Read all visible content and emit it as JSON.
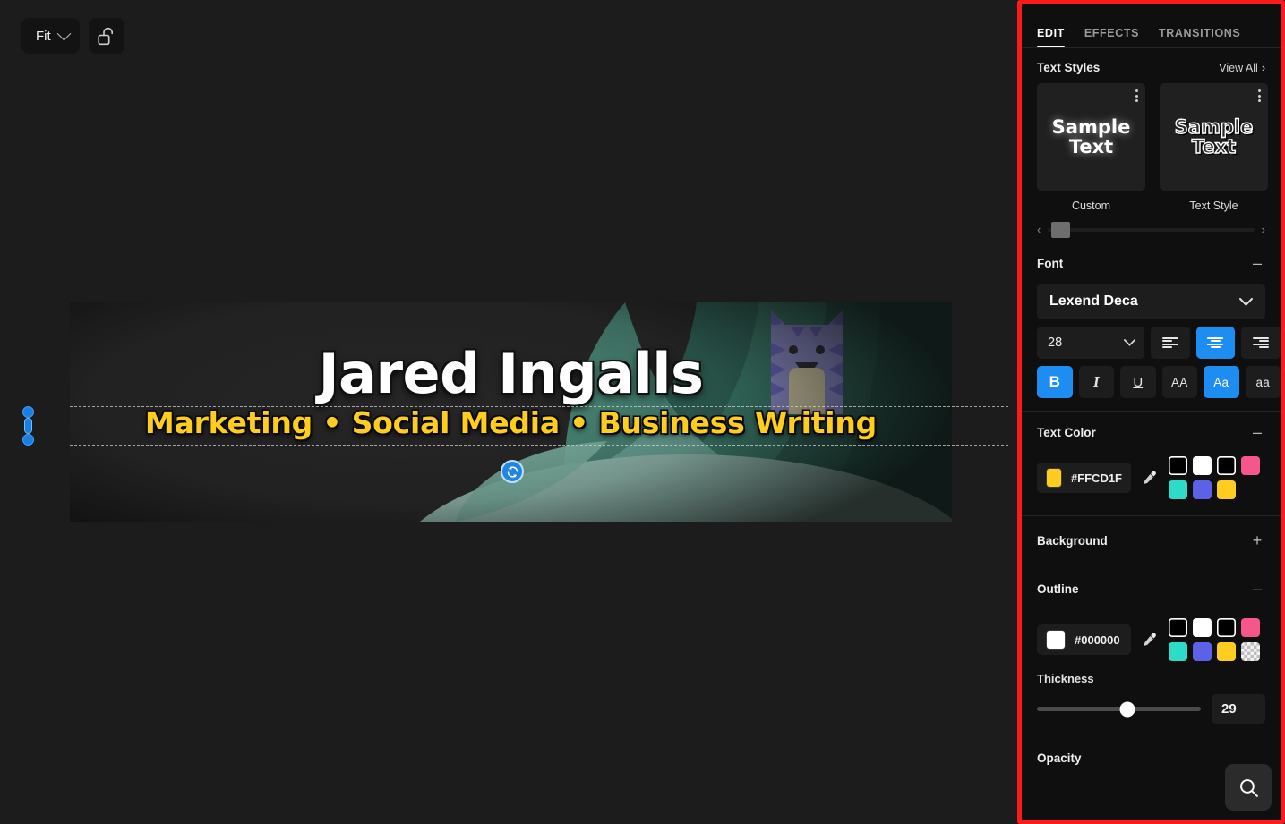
{
  "toolbar": {
    "fit_label": "Fit",
    "fit_icon": "chevron-down-icon",
    "lock_icon": "unlocked-padlock-icon"
  },
  "canvas": {
    "headline": "Jared Ingalls",
    "subline": "Marketing • Social Media • Business Writing",
    "headline_color": "#FFFFFF",
    "subline_color": "#FFCD1F",
    "rotate_icon": "rotate-refresh-icon"
  },
  "panel": {
    "accent_border": "#FB1B1B",
    "tabs": [
      {
        "label": "EDIT",
        "active": true
      },
      {
        "label": "EFFECTS",
        "active": false
      },
      {
        "label": "TRANSITIONS",
        "active": false
      }
    ],
    "text_styles": {
      "title": "Text Styles",
      "view_all": "View All",
      "view_all_icon": "chevron-right-icon",
      "cards": [
        {
          "preview": "Sample Text",
          "label": "Custom",
          "kebab_icon": "more-vertical-icon"
        },
        {
          "preview": "Sample Text",
          "label": "Text Style",
          "kebab_icon": "more-vertical-icon"
        }
      ],
      "next_icon": "chevron-right-icon",
      "scroll_left_icon": "chevron-left-icon",
      "scroll_right_icon": "chevron-right-icon"
    },
    "font": {
      "title": "Font",
      "collapse_icon": "minus-icon",
      "family": "Lexend Deca",
      "family_chevron": "chevron-down-icon",
      "size": "28",
      "size_chevron": "chevron-down-icon",
      "align_left": "align-left-icon",
      "align_center": "align-center-icon",
      "align_right": "align-right-icon",
      "bold": "B",
      "italic": "I",
      "underline": "U",
      "uppercase": "AA",
      "titlecase": "Aa",
      "lowercase": "aa",
      "active_align": "center",
      "bold_active": true,
      "titlecase_active": true
    },
    "text_color": {
      "title": "Text Color",
      "collapse_icon": "minus-icon",
      "hex": "#FFCD1F",
      "chip": "#FFCD1F",
      "eyedropper_icon": "eyedropper-icon",
      "swatches": [
        "#000000",
        "#FFFFFF",
        "#000000",
        "#F5578B",
        "#2CDCC8",
        "#5C62E8",
        "#FFCD1F"
      ]
    },
    "background": {
      "title": "Background",
      "expand_icon": "plus-icon"
    },
    "outline": {
      "title": "Outline",
      "collapse_icon": "minus-icon",
      "hex": "#000000",
      "chip": "#000000",
      "eyedropper_icon": "eyedropper-icon",
      "swatches": [
        "#000000",
        "#FFFFFF",
        "#000000",
        "#F5578B",
        "#2CDCC8",
        "#5C62E8",
        "#FFCD1F",
        "transparent"
      ],
      "thickness_label": "Thickness",
      "thickness_value": "29",
      "thickness_percent": 55
    },
    "opacity": {
      "title": "Opacity"
    },
    "search_icon": "search-icon"
  }
}
